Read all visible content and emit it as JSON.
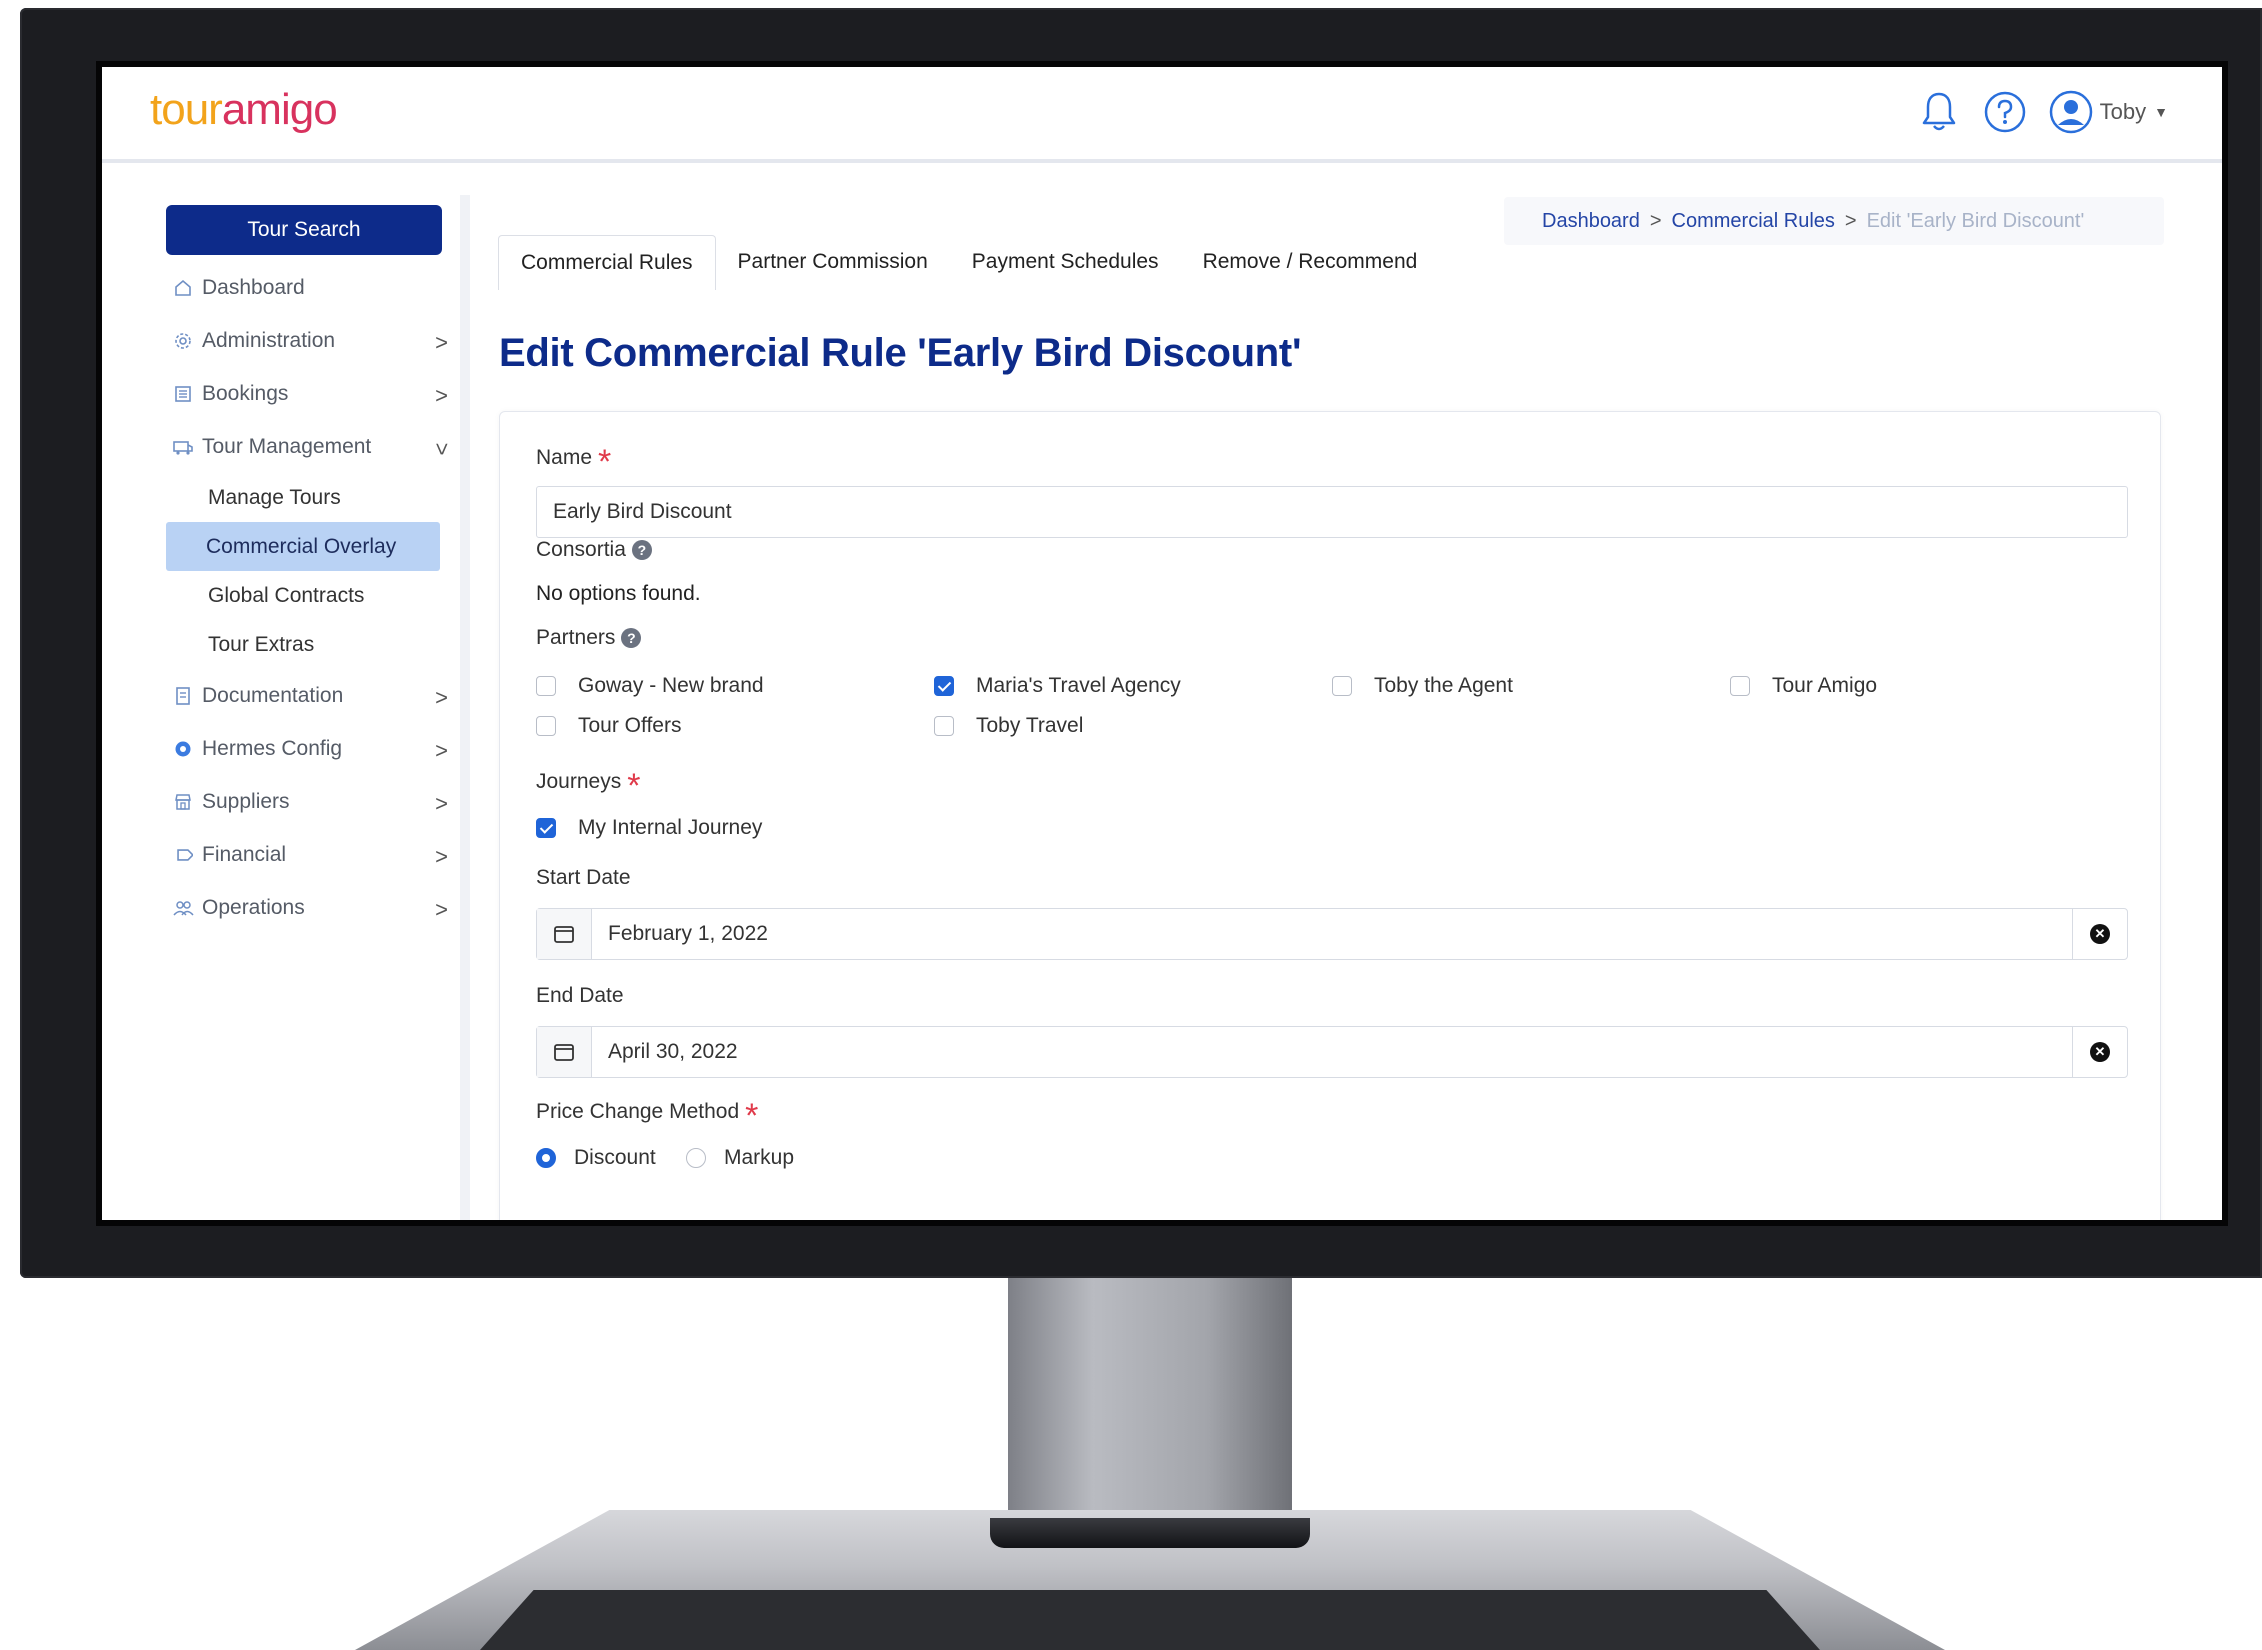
{
  "logo": {
    "part1": "tour",
    "part2": "amigo"
  },
  "header": {
    "user_name": "Toby"
  },
  "sidebar": {
    "tour_search": "Tour Search",
    "items": [
      {
        "label": "Dashboard",
        "icon": "home-icon"
      },
      {
        "label": "Administration",
        "icon": "gear-icon"
      },
      {
        "label": "Bookings",
        "icon": "bookings-icon"
      },
      {
        "label": "Tour Management",
        "icon": "bus-icon"
      },
      {
        "label": "Documentation",
        "icon": "document-icon"
      },
      {
        "label": "Hermes Config",
        "icon": "settings-icon"
      },
      {
        "label": "Suppliers",
        "icon": "store-icon"
      },
      {
        "label": "Financial",
        "icon": "tag-icon"
      },
      {
        "label": "Operations",
        "icon": "users-icon"
      }
    ],
    "sub_items": [
      "Manage Tours",
      "Commercial Overlay",
      "Global Contracts",
      "Tour Extras"
    ],
    "active_sub": "Commercial Overlay"
  },
  "breadcrumb": {
    "item1": "Dashboard",
    "item2": "Commercial Rules",
    "current": "Edit 'Early Bird Discount'",
    "sep": ">"
  },
  "tabs": [
    "Commercial Rules",
    "Partner Commission",
    "Payment Schedules",
    "Remove / Recommend"
  ],
  "page_title": "Edit Commercial Rule 'Early Bird Discount'",
  "form": {
    "name_label": "Name",
    "name_value": "Early Bird Discount",
    "consortia_label": "Consortia",
    "consortia_empty": "No options found.",
    "partners_label": "Partners",
    "partners": [
      {
        "label": "Goway - New brand",
        "checked": false
      },
      {
        "label": "Maria's Travel Agency",
        "checked": true
      },
      {
        "label": "Toby the Agent",
        "checked": false
      },
      {
        "label": "Tour Amigo",
        "checked": false
      },
      {
        "label": "Tour Offers",
        "checked": false
      },
      {
        "label": "Toby Travel",
        "checked": false
      }
    ],
    "journeys_label": "Journeys",
    "journeys": [
      {
        "label": "My Internal Journey",
        "checked": true
      }
    ],
    "start_date_label": "Start Date",
    "start_date_value": "February 1, 2022",
    "end_date_label": "End Date",
    "end_date_value": "April 30, 2022",
    "price_change_label": "Price Change Method",
    "price_methods": [
      {
        "label": "Discount",
        "selected": true
      },
      {
        "label": "Markup",
        "selected": false
      }
    ]
  },
  "colors": {
    "brand_navy": "#0d2b8a",
    "logo_orange": "#f2a31b",
    "logo_pink": "#d8325e",
    "required_red": "#e03a4a",
    "checkbox_blue": "#1f64d8"
  }
}
